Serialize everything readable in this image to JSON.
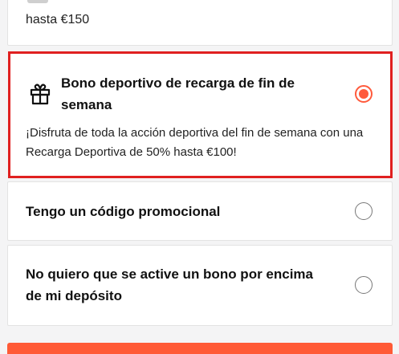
{
  "previous_option": {
    "subtext": "hasta €150"
  },
  "options": [
    {
      "title": "Bono deportivo de recarga de fin de semana",
      "description": "¡Disfruta de toda la acción deportiva del fin de semana con una Recarga Deportiva de 50% hasta €100!",
      "icon": "gift-icon",
      "selected": true
    },
    {
      "title": "Tengo un código promocional",
      "selected": false
    },
    {
      "title": "No quiero que se active un bono por encima de mi depósito",
      "selected": false
    }
  ],
  "colors": {
    "accent": "#ff5a3c",
    "highlight_border": "#e02020",
    "background": "#f4f4f5"
  }
}
